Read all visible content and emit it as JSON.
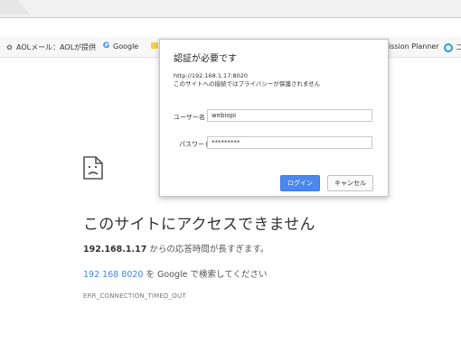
{
  "bookmarks": [
    {
      "icon": "aol-icon",
      "label": "AOLメール：AOLが提供"
    },
    {
      "icon": "google-icon",
      "label": "Google"
    },
    {
      "icon": "folder-icon",
      "label": ""
    },
    {
      "icon": "bookmark-icon",
      "label": "ission Planner"
    },
    {
      "icon": "circle-icon",
      "label": "コ"
    }
  ],
  "dialog": {
    "title": "認証が必要です",
    "url": "http://192.168.1.17:8020",
    "note": "このサイトへの接続ではプライバシーが保護されません",
    "username_label": "ユーザー名",
    "username_value": "webiopi",
    "password_label": "パスワード",
    "password_value": "*********",
    "login_label": "ログイン",
    "cancel_label": "キャンセル"
  },
  "error": {
    "title": "このサイトにアクセスできません",
    "host": "192.168.1.17",
    "timeout_text": " からの応答時間が長すぎます。",
    "search_link": "192 168 8020",
    "search_text": " を Google で検索してください",
    "code": "ERR_CONNECTION_TIMED_OUT"
  }
}
